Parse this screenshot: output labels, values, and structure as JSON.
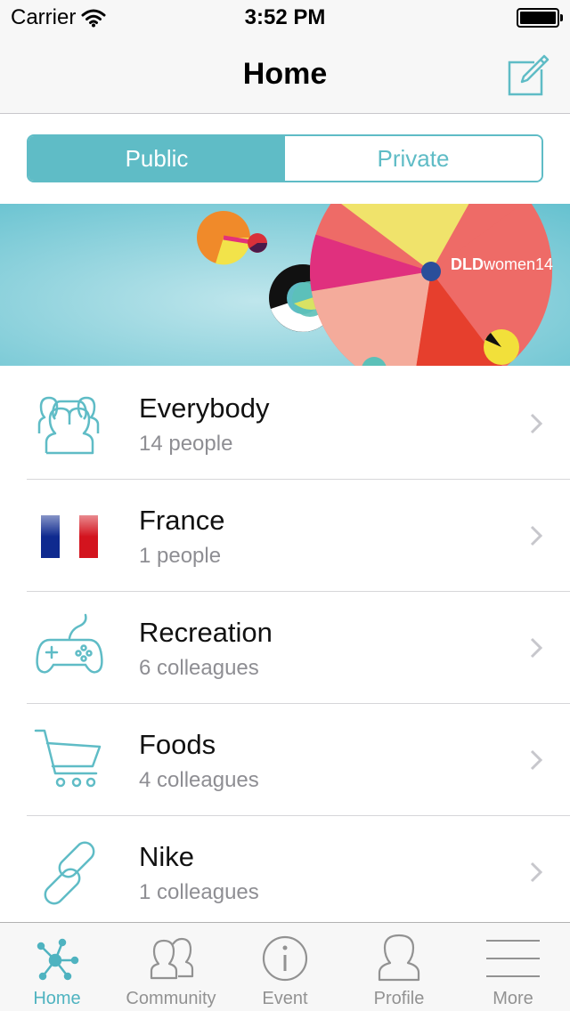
{
  "status_bar": {
    "carrier": "Carrier",
    "time": "3:52 PM"
  },
  "nav": {
    "title": "Home",
    "compose_icon": "compose-icon"
  },
  "segment": {
    "public_label": "Public",
    "private_label": "Private",
    "selected": "Public"
  },
  "banner": {
    "brand_bold": "DLD",
    "brand_rest": "women14"
  },
  "groups": [
    {
      "title": "Everybody",
      "subtitle": "14 people",
      "icon": "group-people-icon"
    },
    {
      "title": "France",
      "subtitle": "1 people",
      "icon": "france-flag-icon"
    },
    {
      "title": "Recreation",
      "subtitle": "6 colleagues",
      "icon": "gamepad-icon"
    },
    {
      "title": "Foods",
      "subtitle": "4 colleagues",
      "icon": "shopping-cart-icon"
    },
    {
      "title": "Nike",
      "subtitle": "1 colleagues",
      "icon": "link-icon"
    }
  ],
  "tab_bar": {
    "tabs": [
      {
        "label": "Home",
        "icon": "network-icon",
        "active": true
      },
      {
        "label": "Community",
        "icon": "community-icon",
        "active": false
      },
      {
        "label": "Event",
        "icon": "info-icon",
        "active": false
      },
      {
        "label": "Profile",
        "icon": "profile-icon",
        "active": false
      },
      {
        "label": "More",
        "icon": "menu-icon",
        "active": false
      }
    ]
  },
  "colors": {
    "accent": "#5fbcc6",
    "tab_active": "#4fb3c0",
    "subtitle": "#8e8e93"
  }
}
